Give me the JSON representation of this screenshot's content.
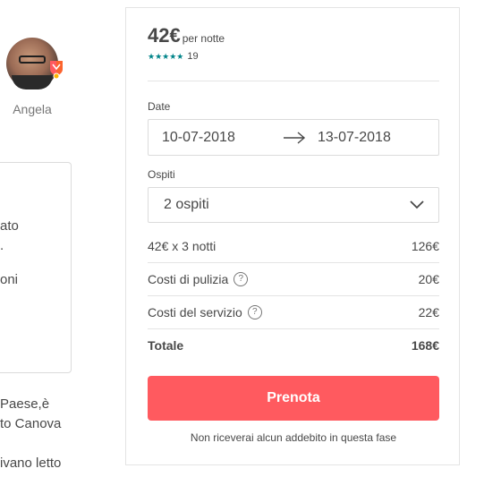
{
  "host": {
    "name": "Angela",
    "badge_colors": [
      "#ff5a5f",
      "#fc642d",
      "#ffb400"
    ]
  },
  "description_fragments": {
    "box_line1": "ato",
    "box_line2": ".",
    "box_line3": "oni",
    "below_line1": "Paese,è",
    "below_line2": "to Canova",
    "below_line3": "ivano letto"
  },
  "booking": {
    "price": "42€",
    "price_unit": "per notte",
    "stars": "★★★★★",
    "review_count": "19",
    "dates_label": "Date",
    "check_in": "10-07-2018",
    "check_out": "13-07-2018",
    "guests_label": "Ospiti",
    "guests_value": "2 ospiti",
    "lines": [
      {
        "label": "42€ x 3 notti",
        "amount": "126€"
      },
      {
        "label": "Costi di pulizia",
        "amount": "20€"
      },
      {
        "label": "Costi del servizio",
        "amount": "22€"
      }
    ],
    "total_label": "Totale",
    "total_amount": "168€",
    "book_label": "Prenota",
    "note": "Non riceverai alcun addebito in questa fase",
    "accent_color": "#ff5a5f",
    "star_color": "#008489"
  }
}
